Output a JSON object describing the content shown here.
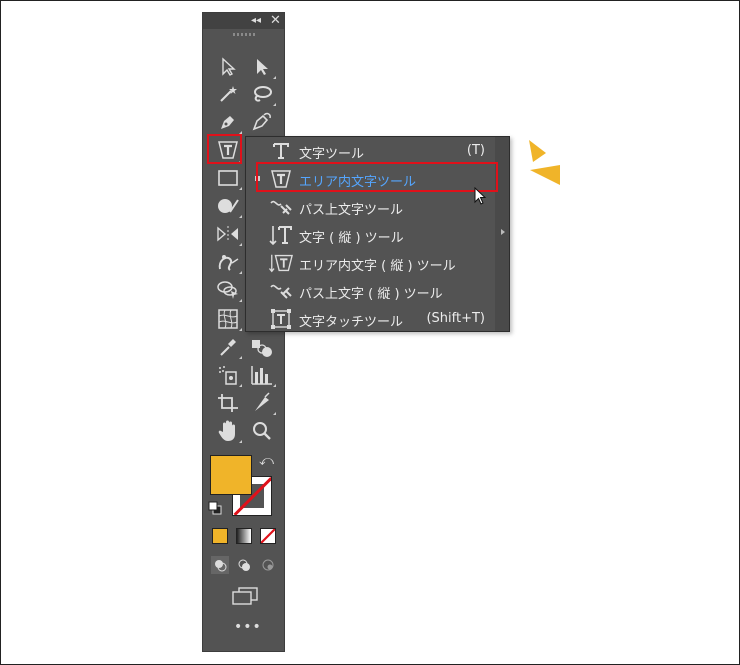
{
  "panel": {
    "collapse_icon": "double-chevron-left-icon",
    "close_icon": "close-icon",
    "tools": [
      {
        "name": "selection-tool",
        "icon": "arrow-outline"
      },
      {
        "name": "direct-selection-tool",
        "icon": "arrow-filled"
      },
      {
        "name": "magic-wand-tool",
        "icon": "magic-wand"
      },
      {
        "name": "lasso-tool",
        "icon": "lasso"
      },
      {
        "name": "pen-tool",
        "icon": "pen"
      },
      {
        "name": "curvature-tool",
        "icon": "curvature"
      },
      {
        "name": "type-tool",
        "icon": "area-type"
      },
      {
        "name": "rectangle-tool",
        "icon": "rectangle"
      },
      {
        "name": "shaper-tool",
        "icon": "shaper"
      },
      {
        "name": "reflect-tool",
        "icon": "reflect"
      },
      {
        "name": "warp-tool",
        "icon": "warp"
      },
      {
        "name": "shape-builder-tool",
        "icon": "shape-builder"
      },
      {
        "name": "mesh-tool",
        "icon": "mesh"
      },
      {
        "name": "eyedropper-tool",
        "icon": "eyedropper"
      },
      {
        "name": "blend-tool",
        "icon": "blend"
      },
      {
        "name": "symbol-sprayer-tool",
        "icon": "symbol-sprayer"
      },
      {
        "name": "column-graph-tool",
        "icon": "column-graph"
      },
      {
        "name": "artboard-tool",
        "icon": "artboard"
      },
      {
        "name": "slice-tool",
        "icon": "slice"
      },
      {
        "name": "hand-tool",
        "icon": "hand"
      },
      {
        "name": "zoom-tool",
        "icon": "magnifier"
      }
    ],
    "fill_color": "#f0b429",
    "stroke_color": "none",
    "more_label": "•••"
  },
  "flyout": {
    "items": [
      {
        "label": "文字ツール",
        "shortcut": "(T)",
        "icon": "type-icon",
        "active": false
      },
      {
        "label": "エリア内文字ツール",
        "shortcut": "",
        "icon": "area-type-icon",
        "active": true
      },
      {
        "label": "パス上文字ツール",
        "shortcut": "",
        "icon": "type-on-path-icon",
        "active": false
      },
      {
        "label": "文字 ( 縦 ) ツール",
        "shortcut": "",
        "icon": "vertical-type-icon",
        "active": false
      },
      {
        "label": "エリア内文字 ( 縦 ) ツール",
        "shortcut": "",
        "icon": "vertical-area-type-icon",
        "active": false
      },
      {
        "label": "パス上文字 ( 縦 ) ツール",
        "shortcut": "",
        "icon": "vertical-type-on-path-icon",
        "active": false
      },
      {
        "label": "文字タッチツール",
        "shortcut": "(Shift+T)",
        "icon": "touch-type-icon",
        "active": false
      }
    ]
  },
  "colors": {
    "highlight": "#e0111a",
    "accent_marks": "#f0b429",
    "active_text": "#55a6ff",
    "panel_bg": "#535353"
  }
}
